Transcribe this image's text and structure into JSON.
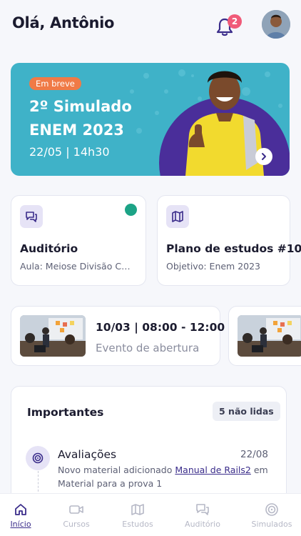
{
  "header": {
    "greeting": "Olá, Antônio",
    "notification_count": "2",
    "bell_icon": "bell-icon",
    "avatar_icon": "user-avatar"
  },
  "hero": {
    "badge": "Em breve",
    "title": "2º Simulado ENEM 2023",
    "date": "22/05 | 14h30",
    "colors": {
      "background": "#3FB2C8",
      "badge": "#F07A46",
      "circle": "#4A2E9A"
    }
  },
  "cards": [
    {
      "icon": "chat-icon",
      "title": "Auditório",
      "subtitle": "Aula: Meiose Divisão Celular",
      "status": "online"
    },
    {
      "icon": "map-icon",
      "title": "Plano de estudos #10",
      "subtitle": "Objetivo: Enem 2023"
    }
  ],
  "events": [
    {
      "time": "10/03 | 08:00 - 12:00",
      "name": "Evento de abertura"
    }
  ],
  "important": {
    "title": "Importantes",
    "unread": "5 não lidas",
    "items": [
      {
        "icon": "target-icon",
        "title": "Avaliações",
        "date": "22/08",
        "text_before": "Novo material adicionado ",
        "link": "Manual de Rails2",
        "text_after": " em Material para a prova 1"
      }
    ]
  },
  "tabbar": {
    "accent": "#3A2C8A",
    "items": [
      {
        "label": "Início",
        "icon": "home-icon",
        "active": true
      },
      {
        "label": "Cursos",
        "icon": "video-icon"
      },
      {
        "label": "Estudos",
        "icon": "map-icon"
      },
      {
        "label": "Auditório",
        "icon": "chat-icon"
      },
      {
        "label": "Simulados",
        "icon": "target-icon"
      }
    ]
  }
}
